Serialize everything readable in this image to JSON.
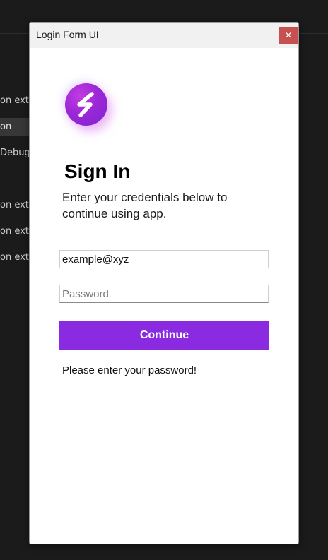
{
  "background_app": {
    "items": [
      {
        "label": "on exte",
        "selected": false
      },
      {
        "label": "on",
        "selected": true
      },
      {
        "label": "Debug",
        "selected": false
      },
      {
        "label": "on exte",
        "selected": false
      },
      {
        "label": "on exte",
        "selected": false
      },
      {
        "label": "on exte",
        "selected": false
      }
    ]
  },
  "window": {
    "title": "Login Form UI",
    "close_label": "✕"
  },
  "logo": {
    "icon": "lightning-bolt-logo",
    "gradient": [
      "#c13de0",
      "#7b25d1"
    ]
  },
  "form": {
    "heading": "Sign In",
    "subtitle": "Enter your credentials below to continue using app.",
    "email": {
      "value": "example@xyz",
      "placeholder": ""
    },
    "password": {
      "value": "",
      "placeholder": "Password"
    },
    "continue_label": "Continue",
    "message": "Please enter your password!"
  },
  "colors": {
    "accent": "#8a2be2",
    "close_button": "#c75050",
    "background": "#1b1b1b"
  }
}
